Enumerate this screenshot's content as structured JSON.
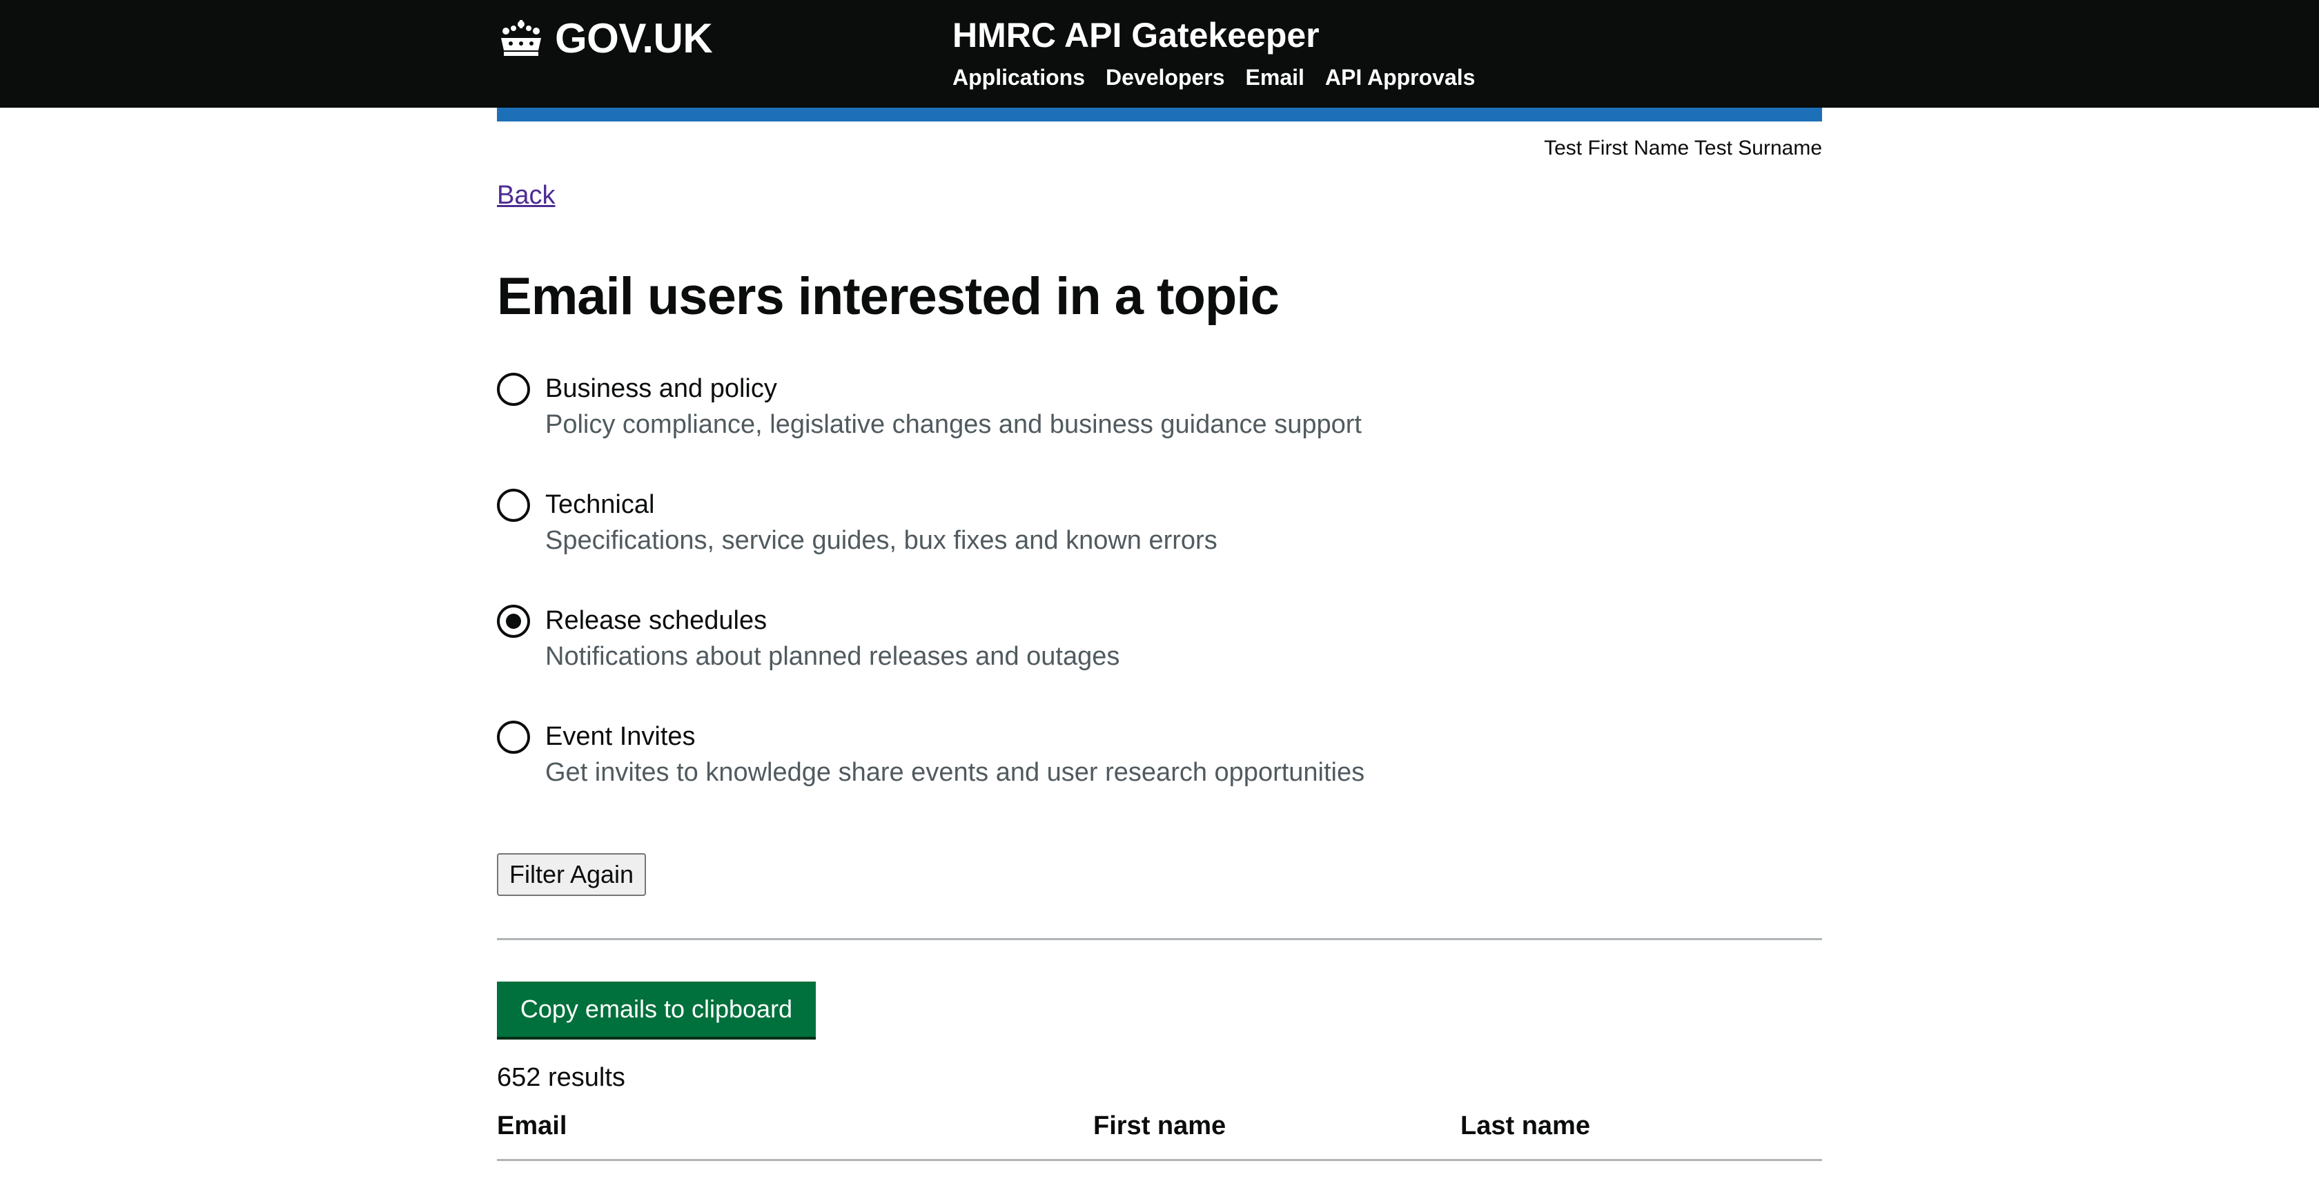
{
  "header": {
    "logo_text": "GOV.UK",
    "service_name": "HMRC API Gatekeeper",
    "nav": [
      "Applications",
      "Developers",
      "Email",
      "API Approvals"
    ]
  },
  "user": {
    "name": "Test First Name Test Surname"
  },
  "back_link": "Back",
  "page_title": "Email users interested in a topic",
  "topics": [
    {
      "label": "Business and policy",
      "hint": "Policy compliance, legislative changes and business guidance support",
      "checked": false
    },
    {
      "label": "Technical",
      "hint": "Specifications, service guides, bux fixes and known errors",
      "checked": false
    },
    {
      "label": "Release schedules",
      "hint": "Notifications about planned releases and outages",
      "checked": true
    },
    {
      "label": "Event Invites",
      "hint": "Get invites to knowledge share events and user research opportunities",
      "checked": false
    }
  ],
  "filter_button": "Filter Again",
  "copy_button": "Copy emails to clipboard",
  "results_count": "652 results",
  "table": {
    "columns": [
      "Email",
      "First name",
      "Last name"
    ]
  },
  "colors": {
    "header_bg": "#0b0c0c",
    "accent_blue": "#1d70b8",
    "button_green": "#00703c",
    "link_visited": "#4c2c92",
    "hint_grey": "#505a5f"
  }
}
